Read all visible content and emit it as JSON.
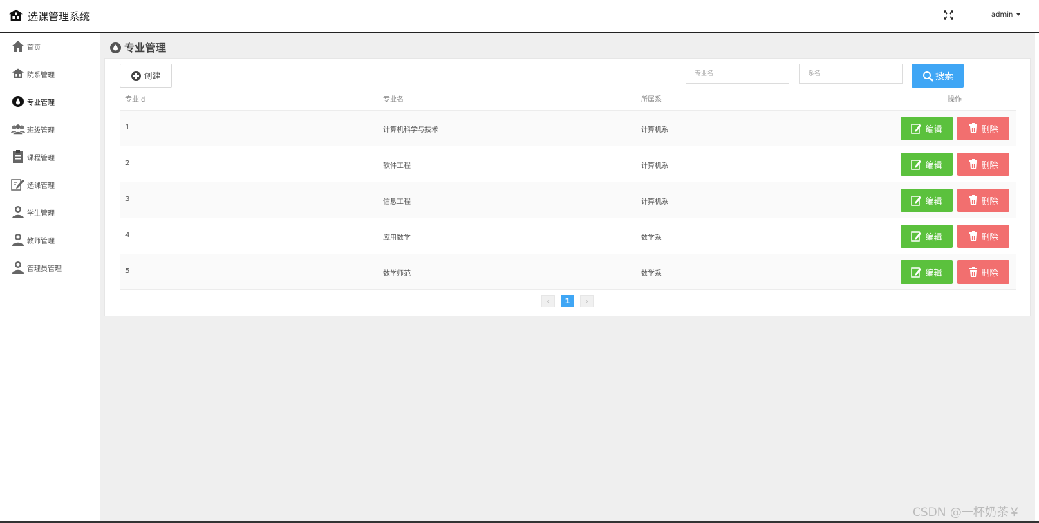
{
  "header": {
    "title": "选课管理系统",
    "user": "admin",
    "logo_icon": "school-icon",
    "fullscreen_icon": "fullscreen-icon"
  },
  "sidebar": {
    "items": [
      {
        "label": "首页",
        "icon": "home-icon"
      },
      {
        "label": "院系管理",
        "icon": "school-icon"
      },
      {
        "label": "专业管理",
        "icon": "drop-icon",
        "active": true
      },
      {
        "label": "班级管理",
        "icon": "group-icon"
      },
      {
        "label": "课程管理",
        "icon": "clipboard-icon"
      },
      {
        "label": "选课管理",
        "icon": "edit-note-icon"
      },
      {
        "label": "学生管理",
        "icon": "user-icon"
      },
      {
        "label": "教师管理",
        "icon": "user-icon"
      },
      {
        "label": "管理员管理",
        "icon": "user-icon"
      }
    ]
  },
  "main": {
    "title": "专业管理",
    "create_label": "创建",
    "search": {
      "major_placeholder": "专业名",
      "dept_placeholder": "系名",
      "button_label": "搜索"
    },
    "table": {
      "headers": [
        "专业Id",
        "专业名",
        "所属系",
        "操作"
      ],
      "rows": [
        {
          "id": "1",
          "name": "计算机科学与技术",
          "dept": "计算机系"
        },
        {
          "id": "2",
          "name": "软件工程",
          "dept": "计算机系"
        },
        {
          "id": "3",
          "name": "信息工程",
          "dept": "计算机系"
        },
        {
          "id": "4",
          "name": "应用数学",
          "dept": "数学系"
        },
        {
          "id": "5",
          "name": "数学师范",
          "dept": "数学系"
        }
      ],
      "edit_label": "编辑",
      "delete_label": "删除"
    },
    "pager": {
      "prev": "‹",
      "current": "1",
      "next": "›"
    }
  },
  "watermark": "CSDN @一杯奶茶￥",
  "colors": {
    "primary": "#3fa6f5",
    "edit": "#5bc13d",
    "delete": "#f26f6f",
    "bg": "#efefef"
  }
}
